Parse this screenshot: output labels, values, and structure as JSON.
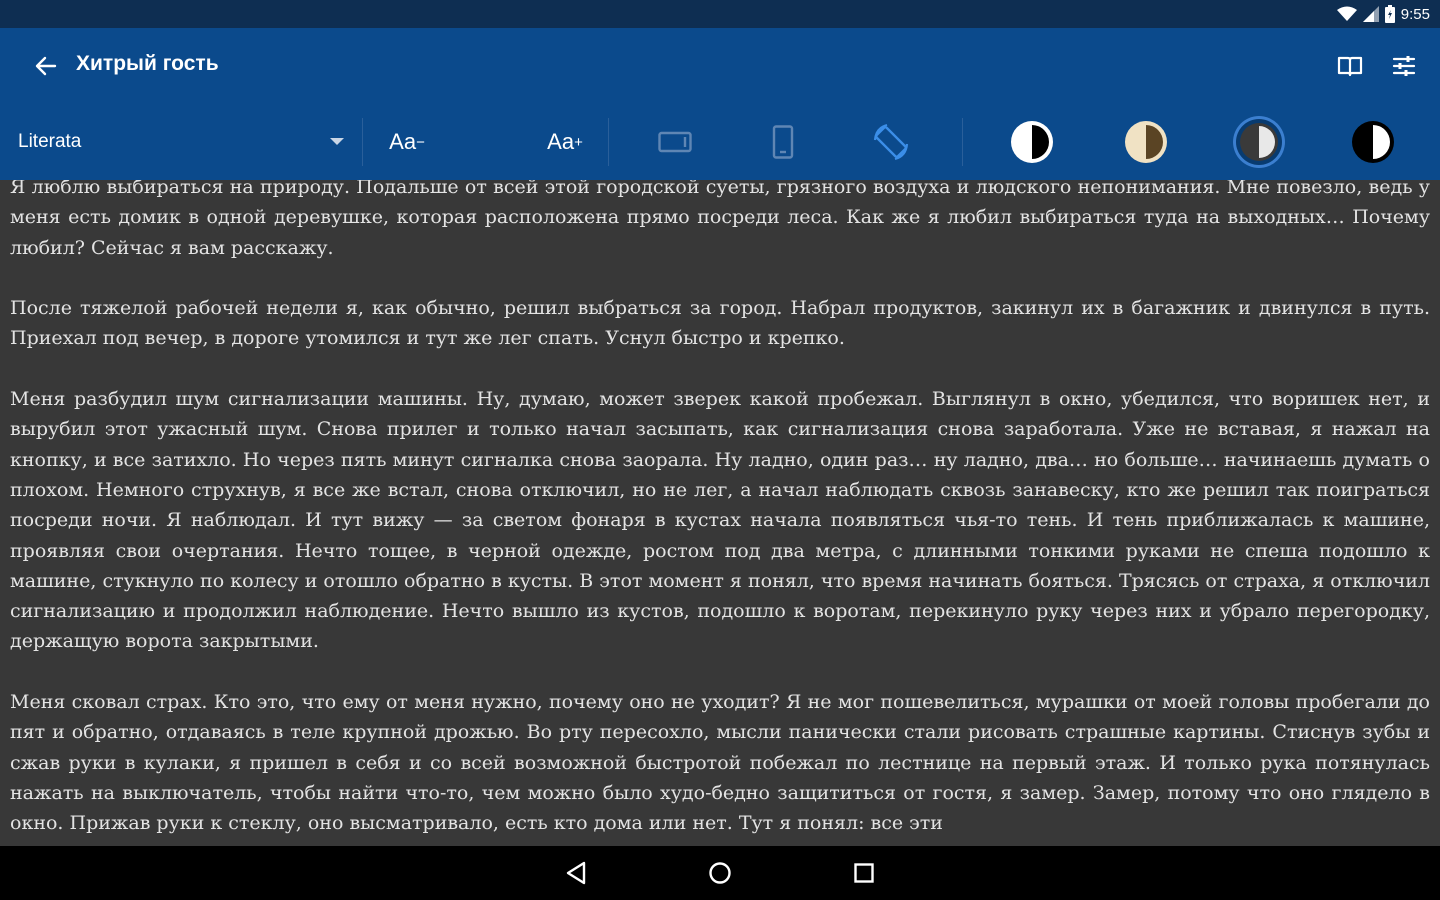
{
  "status_bar": {
    "time": "9:55",
    "icons": [
      "wifi-icon",
      "signal-icon",
      "battery-icon"
    ]
  },
  "app_bar": {
    "title": "Хитрый гость",
    "back_icon": "arrow-left-icon",
    "actions": [
      "book-icon",
      "sliders-icon"
    ]
  },
  "toolbar": {
    "font_name": "Literata",
    "decrease_label": "Aa",
    "decrease_suffix": "−",
    "increase_label": "Aa",
    "increase_suffix": "+",
    "orientation_icons": [
      "landscape-icon",
      "portrait-icon",
      "auto-rotate-icon"
    ],
    "themes": [
      "white",
      "sepia",
      "gray",
      "black"
    ],
    "selected_theme": "gray"
  },
  "reader": {
    "paragraphs": [
      "Я люблю выбираться на природу. Подальше от всей этой городской суеты, грязного воздуха и людского непонимания. Мне повезло, ведь у меня есть домик в одной деревушке, которая расположена прямо посреди леса. Как же я любил выбираться туда на выходных… Почему любил? Сейчас я вам расскажу.",
      "После тяжелой рабочей недели я, как обычно, решил выбраться за город. Набрал продуктов, закинул их в багажник и двинулся в путь. Приехал под вечер, в дороге утомился и тут же лег спать. Уснул быстро и крепко.",
      "Меня разбудил шум сигнализации машины. Ну, думаю, может зверек какой пробежал. Выглянул в окно, убедился, что воришек нет, и вырубил этот ужасный шум. Снова прилег и только начал засыпать, как сигнализация снова заработала. Уже не вставая, я нажал на кнопку, и все затихло. Но через пять минут сигналка снова заорала. Ну ладно, один раз… ну ладно, два… но больше… начинаешь думать о плохом. Немного струхнув, я все же встал, снова отключил, но не лег, а начал наблюдать сквозь занавеску, кто же решил так поиграться посреди ночи. Я наблюдал. И тут вижу — за светом фонаря в кустах начала появляться чья-то тень. И тень приближалась к машине, проявляя свои очертания. Нечто тощее, в черной одежде, ростом под два метра, с длинными тонкими руками не спеша подошло к машине, стукнуло по колесу и отошло обратно в кусты. В этот момент я понял, что время начинать бояться. Трясясь от страха, я отключил сигнализацию и продолжил наблюдение. Нечто вышло из кустов, подошло к воротам, перекинуло руку через них и убрало перегородку, держащую ворота закрытыми.",
      "Меня сковал страх. Кто это, что ему от меня нужно, почему оно не уходит? Я не мог пошевелиться, мурашки от моей головы пробегали до пят и обратно, отдаваясь в теле крупной дрожью. Во рту пересохло, мысли панически стали рисовать страшные картины. Стиснув зубы и сжав руки в кулаки, я пришел в себя и со всей возможной быстротой побежал по лестнице на первый этаж. И только рука потянулась нажать на выключатель, чтобы найти что-то, чем можно было худо-бедно защититься от гостя, я замер. Замер, потому что оно глядело в окно. Прижав руки к стеклу, оно высматривало, есть кто дома или нет. Тут я понял: все эти"
    ]
  },
  "nav_bar": {
    "buttons": [
      "back-triangle-icon",
      "home-circle-icon",
      "recents-square-icon"
    ]
  },
  "colors": {
    "status_bar": "#0e2e52",
    "app_bar": "#0b4a8c",
    "reader_bg": "#383838",
    "reader_text": "#e3e3e3",
    "accent": "#3b7fd0"
  }
}
